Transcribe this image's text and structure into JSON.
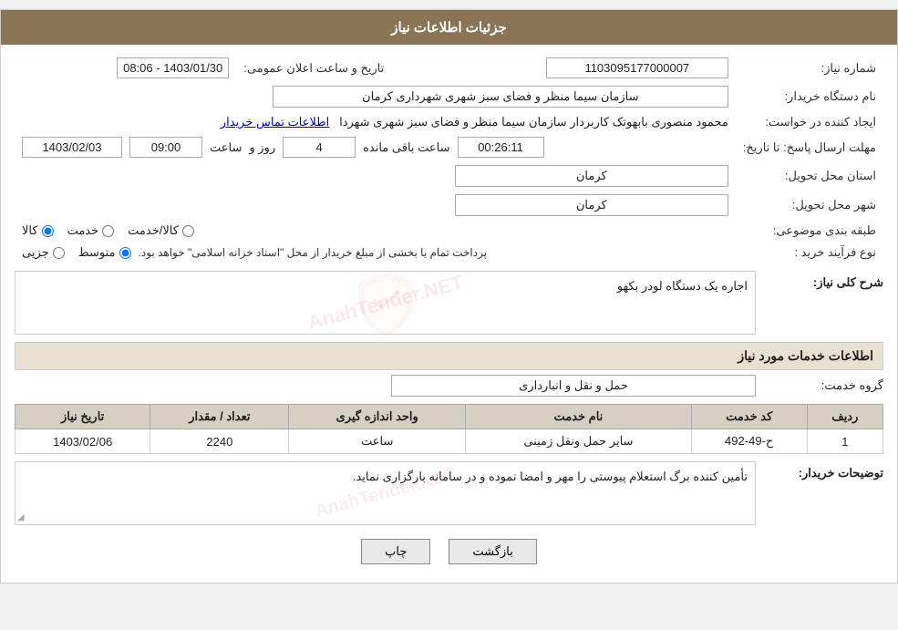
{
  "page": {
    "title": "جزئیات اطلاعات نیاز"
  },
  "header": {
    "label_need_number": "شماره نیاز:",
    "label_date": "تاریخ و ساعت اعلان عمومی:",
    "label_org": "نام دستگاه خریدار:",
    "label_creator": "ایجاد کننده در خواست:",
    "label_deadline": "مهلت ارسال پاسخ: تا تاریخ:",
    "label_province": "استان محل تحویل:",
    "label_city": "شهر محل تحویل:",
    "label_category": "طبقه بندی موضوعی:",
    "label_process": "نوع فرآیند خرید :",
    "need_number": "1103095177000007",
    "date_value": "1403/01/30 - 08:06",
    "org_name": "سازمان سیما منظر و فضای سبز شهری شهرداری کرمان",
    "creator_name": "محمود منصوری بابهوتک کاربردار سازمان سیما منظر و فضای سبز شهری شهردا",
    "creator_link": "اطلاعات تماس خریدار",
    "deadline_date": "1403/02/03",
    "deadline_time": "09:00",
    "deadline_days": "4",
    "deadline_remaining": "00:26:11",
    "deadline_remaining_label": "ساعت باقی مانده",
    "deadline_days_label": "روز و",
    "deadline_time_label": "ساعت",
    "province_value": "کرمان",
    "city_value": "کرمان",
    "category_options": [
      "کالا",
      "خدمت",
      "کالا/خدمت"
    ],
    "category_selected": "کالا",
    "process_options": [
      "جزیی",
      "متوسط"
    ],
    "process_selected": "متوسط",
    "process_note": "پرداخت تمام یا بخشی از مبلغ خریدار از محل \"اسناد خزانه اسلامی\" خواهد بود."
  },
  "section_description": {
    "title": "شرح کلی نیاز:",
    "value": "اجاره یک دستگاه لودر بکهو"
  },
  "section_services": {
    "title": "اطلاعات خدمات مورد نیاز",
    "label_group": "گروه خدمت:",
    "group_value": "حمل و نقل و انبارداری",
    "table": {
      "columns": [
        "ردیف",
        "کد خدمت",
        "نام خدمت",
        "واحد اندازه گیری",
        "تعداد / مقدار",
        "تاریخ نیاز"
      ],
      "rows": [
        {
          "row": "1",
          "code": "ح-49-492",
          "name": "سایر حمل ونقل زمینی",
          "unit": "ساعت",
          "qty": "2240",
          "date": "1403/02/06"
        }
      ]
    }
  },
  "section_buyer": {
    "title": "توضیحات خریدار:",
    "value": "تأمین کننده برگ استعلام پیوستی را مهر و امضا نموده و در سامانه بارگزاری نماید."
  },
  "buttons": {
    "print": "چاپ",
    "back": "بازگشت"
  },
  "watermark": "AnahTender.NET"
}
